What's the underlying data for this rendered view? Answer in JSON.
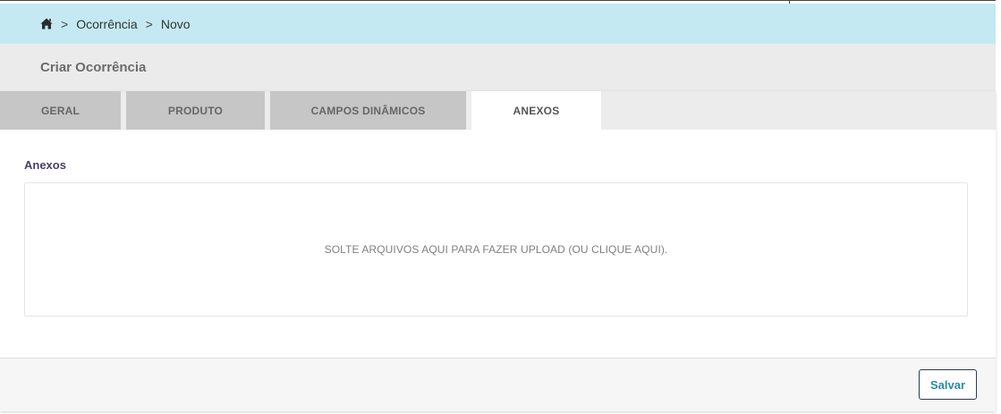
{
  "breadcrumb": {
    "home_icon": "home-icon",
    "separator": ">",
    "items": [
      {
        "label": "Ocorrência"
      },
      {
        "label": "Novo"
      }
    ]
  },
  "page": {
    "title": "Criar Ocorrência"
  },
  "tabs": [
    {
      "label": "GERAL",
      "active": false
    },
    {
      "label": "PRODUTO",
      "active": false
    },
    {
      "label": "CAMPOS DINÂMICOS",
      "active": false
    },
    {
      "label": "ANEXOS",
      "active": true
    }
  ],
  "attachments": {
    "section_label": "Anexos",
    "dropzone_text": "SOLTE ARQUIVOS AQUI PARA FAZER UPLOAD (OU CLIQUE AQUI)."
  },
  "footer": {
    "save_label": "Salvar"
  },
  "colors": {
    "breadcrumb_bg": "#c4e9f2",
    "title_bar_bg": "#ebebeb",
    "tab_inactive_bg": "#c6c6c6",
    "section_label": "#4a3d6e",
    "save_text": "#2a8aa6"
  }
}
